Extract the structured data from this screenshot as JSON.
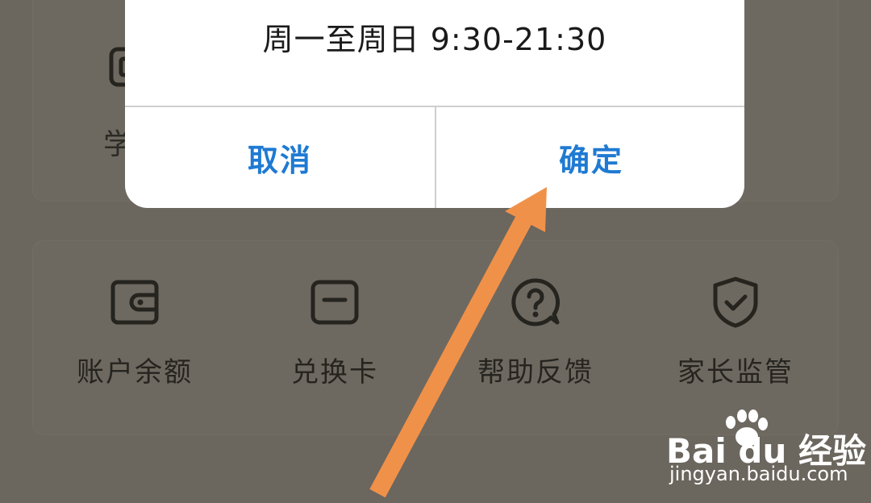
{
  "dialog": {
    "message": "周一至周日 9:30-21:30",
    "cancel_label": "取消",
    "confirm_label": "确定"
  },
  "partial_item": {
    "label": "学",
    "icon": "app-square-icon"
  },
  "grid": [
    {
      "label": "账户余额",
      "icon": "wallet-icon"
    },
    {
      "label": "兑换卡",
      "icon": "card-icon"
    },
    {
      "label": "帮助反馈",
      "icon": "help-chat-icon"
    },
    {
      "label": "家长监管",
      "icon": "shield-check-icon"
    }
  ],
  "watermark": {
    "logo": "Bai du 经验",
    "url": "jingyan.baidu.com"
  },
  "colors": {
    "accent": "#1f7ad2",
    "overlay": "#6b665e",
    "arrow": "#f0914a",
    "text_dark": "#26241f"
  }
}
